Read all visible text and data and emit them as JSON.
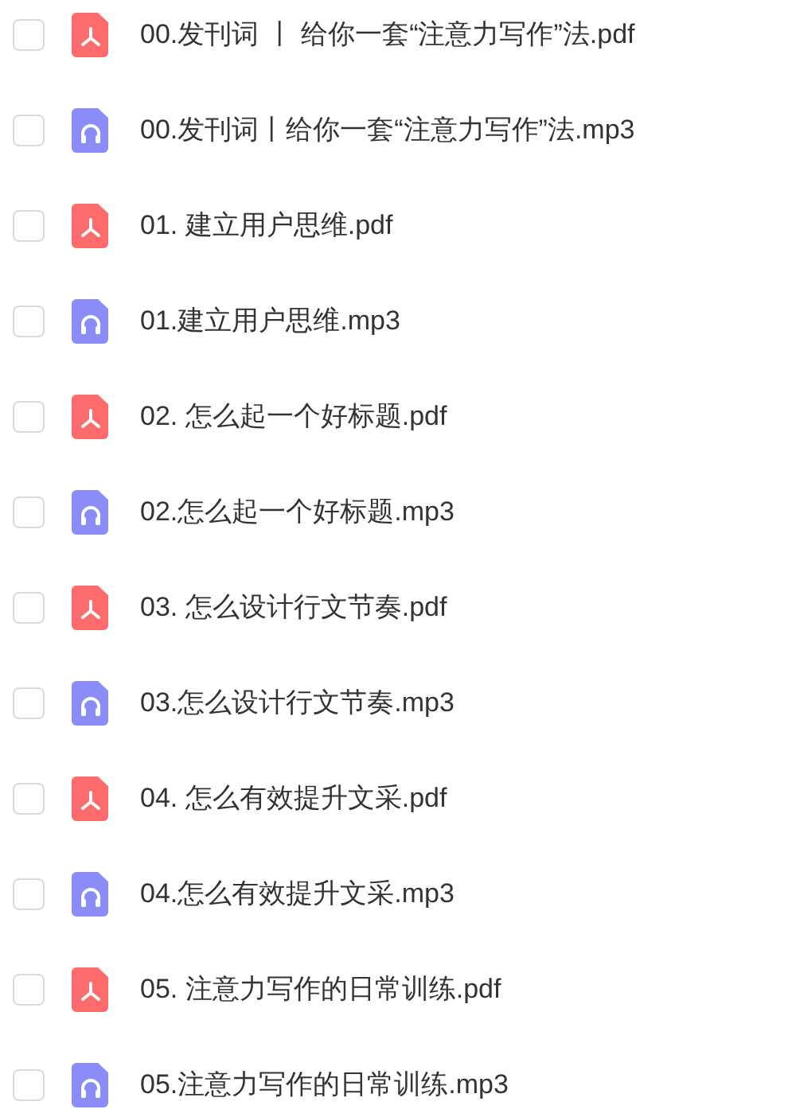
{
  "files": [
    {
      "kind": "pdf",
      "name": "00.发刊词 丨 给你一套“注意力写作”法.pdf",
      "checked": false
    },
    {
      "kind": "audio",
      "name": "00.发刊词丨给你一套“注意力写作”法.mp3",
      "checked": false
    },
    {
      "kind": "pdf",
      "name": "01. 建立用户思维.pdf",
      "checked": false
    },
    {
      "kind": "audio",
      "name": "01.建立用户思维.mp3",
      "checked": false
    },
    {
      "kind": "pdf",
      "name": "02. 怎么起一个好标题.pdf",
      "checked": false
    },
    {
      "kind": "audio",
      "name": "02.怎么起一个好标题.mp3",
      "checked": false
    },
    {
      "kind": "pdf",
      "name": "03. 怎么设计行文节奏.pdf",
      "checked": false
    },
    {
      "kind": "audio",
      "name": "03.怎么设计行文节奏.mp3",
      "checked": false
    },
    {
      "kind": "pdf",
      "name": "04. 怎么有效提升文采.pdf",
      "checked": false
    },
    {
      "kind": "audio",
      "name": "04.怎么有效提升文采.mp3",
      "checked": false
    },
    {
      "kind": "pdf",
      "name": "05. 注意力写作的日常训练.pdf",
      "checked": false
    },
    {
      "kind": "audio",
      "name": "05.注意力写作的日常训练.mp3",
      "checked": false
    }
  ]
}
